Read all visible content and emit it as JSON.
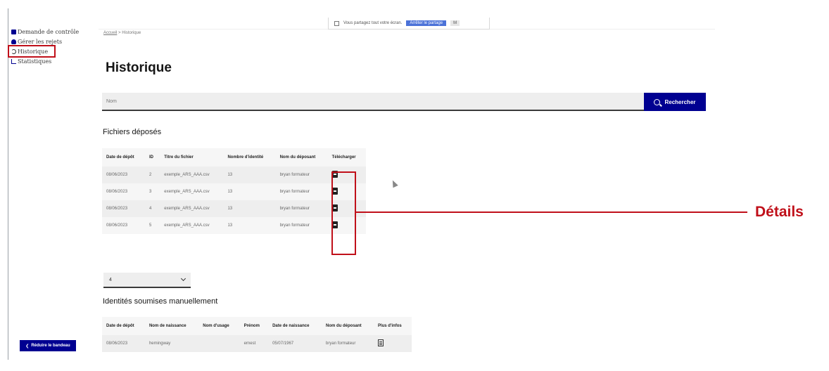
{
  "sidebar": {
    "items": [
      {
        "label": "Demande de contrôle",
        "icon": "document-icon"
      },
      {
        "label": "Gérer les rejets",
        "icon": "user-icon"
      },
      {
        "label": "Historique",
        "icon": "history-icon"
      },
      {
        "label": "Statistiques",
        "icon": "stats-icon"
      }
    ],
    "reduce_label": "Réduire le bandeau"
  },
  "share_bar": {
    "text": "Vous partagez tout votre écran.",
    "stop_label": "Arrêter le partage",
    "hide_label": "M"
  },
  "breadcrumb": {
    "home": "Accueil",
    "separator": ">",
    "current": "Historique"
  },
  "page_title": "Historique",
  "search": {
    "placeholder": "Nom",
    "button_label": "Rechercher"
  },
  "files": {
    "heading": "Fichiers déposés",
    "columns": [
      "Date de dépôt",
      "ID",
      "Titre du fichier",
      "Nombre d'identité",
      "Nom du déposant",
      "Télécharger"
    ],
    "rows": [
      {
        "date": "08/06/2023",
        "id": "2",
        "title": "exemple_ARS_AAA.csv",
        "count": "13",
        "depositor": "bryan formateur"
      },
      {
        "date": "08/06/2023",
        "id": "3",
        "title": "exemple_ARS_AAA.csv",
        "count": "13",
        "depositor": "bryan formateur"
      },
      {
        "date": "08/06/2023",
        "id": "4",
        "title": "exemple_ARS_AAA.csv",
        "count": "13",
        "depositor": "bryan formateur"
      },
      {
        "date": "08/06/2023",
        "id": "5",
        "title": "exemple_ARS_AAA.csv",
        "count": "13",
        "depositor": "bryan formateur"
      }
    ]
  },
  "annotation": {
    "label": "Détails",
    "color": "#c0101a"
  },
  "per_page_select": {
    "value": "4"
  },
  "manual": {
    "heading": "Identités soumises manuellement",
    "columns": [
      "Date de dépôt",
      "Nom de naissance",
      "Nom d'usage",
      "Prénom",
      "Date de naissance",
      "Nom du déposant",
      "Plus d'infos"
    ],
    "rows": [
      {
        "date": "08/06/2023",
        "birth_name": "hemingway",
        "usage_name": "",
        "first_name": "ernest",
        "birth_date": "05/07/1967",
        "depositor": "bryan formateur"
      }
    ]
  },
  "colors": {
    "primary": "#000091",
    "accent_red": "#c0101a",
    "input_bg": "#eeeeee"
  }
}
